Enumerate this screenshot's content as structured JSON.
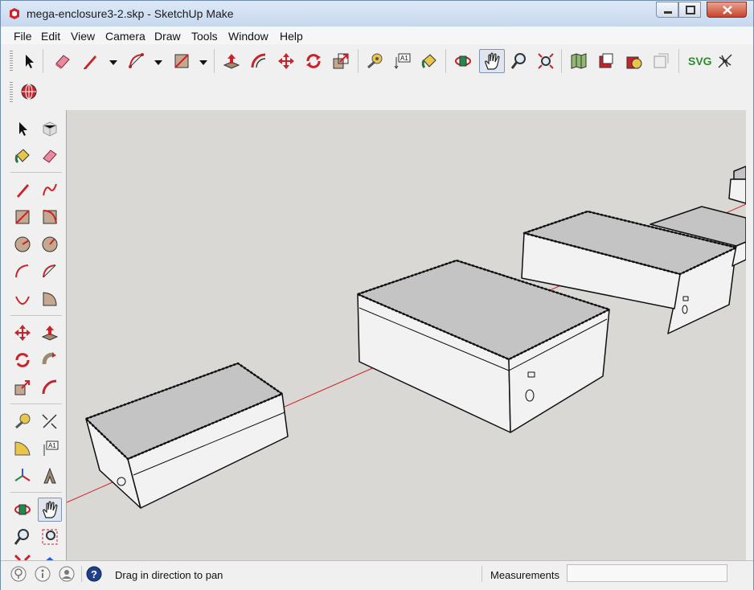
{
  "window": {
    "title": "mega-enclosure3-2.skp - SketchUp Make"
  },
  "menu": [
    "File",
    "Edit",
    "View",
    "Camera",
    "Draw",
    "Tools",
    "Window",
    "Help"
  ],
  "toolbar": {
    "svg_label": "SVG"
  },
  "tools": {
    "select": "select-icon",
    "eraser": "eraser-icon",
    "line": "pencil-icon",
    "arc": "arc-icon",
    "rectangle": "rectangle-icon",
    "push_pull": "push-pull-icon",
    "offset": "offset-icon",
    "move": "move-icon",
    "rotate": "rotate-icon",
    "scale": "scale-icon",
    "tape": "tape-measure-icon",
    "text": "text-icon",
    "paint": "paint-bucket-icon",
    "orbit": "orbit-icon",
    "pan": "pan-hand-icon",
    "zoom": "zoom-icon",
    "zoom_extents": "zoom-extents-icon"
  },
  "statusbar": {
    "hint": "Drag in direction to pan",
    "measurements_label": "Measurements",
    "measurements_value": ""
  },
  "colors": {
    "viewport_bg": "#d9d8d4",
    "box_top": "#c4c4c4",
    "box_side": "#f2f2f2",
    "red_axis": "#d22020",
    "titlebar": "#c6d8ee"
  }
}
